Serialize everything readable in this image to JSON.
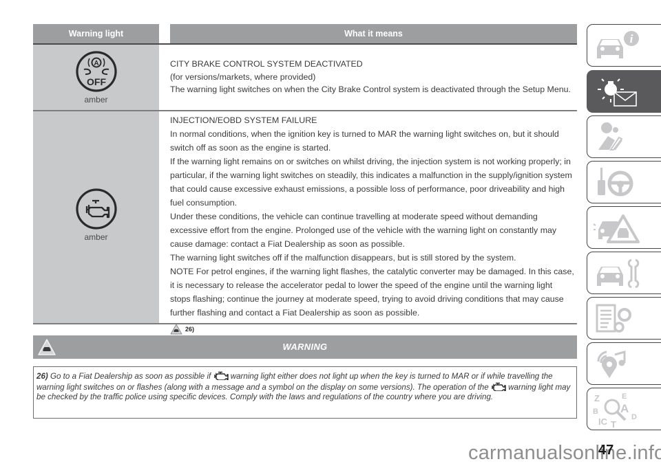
{
  "table": {
    "headers": {
      "warning_light": "Warning light",
      "what_it_means": "What it means"
    },
    "rows": [
      {
        "icon": "city-brake-off-icon",
        "color_label": "amber",
        "lines": [
          "CITY BRAKE CONTROL SYSTEM DEACTIVATED",
          "(for versions/markets, where provided)",
          "The warning light switches on when the City Brake Control system is deactivated through the Setup Menu."
        ]
      },
      {
        "icon": "engine-check-icon",
        "color_label": "amber",
        "lines": [
          "INJECTION/EOBD SYSTEM FAILURE",
          "In normal conditions, when the ignition key is turned to MAR the warning light switches on, but it should switch off as soon as the engine is started.",
          "If the warning light remains on or switches on whilst driving, the injection system is not working properly; in particular, if the warning light switches on steadily, this indicates a malfunction in the supply/ignition system that could cause excessive exhaust emissions, a possible loss of performance, poor driveability and high fuel consumption.",
          "Under these conditions, the vehicle can continue travelling at moderate speed without demanding excessive effort from the engine. Prolonged use of the vehicle with the warning light on constantly may cause damage: contact a Fiat Dealership as soon as possible.",
          "The warning light switches off if the malfunction disappears, but is still stored by the system.",
          "NOTE For petrol engines, if the warning light flashes, the catalytic converter may be damaged. In this case, it is necessary to release the accelerator pedal to lower the speed of the engine until the warning light stops flashing; continue the journey at moderate speed, trying to avoid driving conditions that may cause further flashing and contact a Fiat Dealership as soon as possible."
        ],
        "reference": "26)"
      }
    ]
  },
  "warning": {
    "title": "WARNING",
    "ref_number": "26)",
    "text_part1": " Go to a Fiat Dealership as soon as possible if ",
    "text_part2": " warning light either does not light up when the key is turned to MAR or if while travelling the warning light switches on or flashes (along with a message and a symbol on the display on some versions). The operation of the ",
    "text_part3": " warning light may be checked by the traffic police using specific devices. Comply with the laws and regulations of the country where you are driving."
  },
  "sidebar": {
    "tabs": [
      {
        "name": "car-info-icon",
        "active": false
      },
      {
        "name": "warning-lights-messages-icon",
        "active": true
      },
      {
        "name": "safety-airbag-icon",
        "active": false
      },
      {
        "name": "key-steering-wheel-icon",
        "active": false
      },
      {
        "name": "emergency-icon",
        "active": false
      },
      {
        "name": "maintenance-icon",
        "active": false
      },
      {
        "name": "technical-data-icon",
        "active": false
      },
      {
        "name": "multimedia-icon",
        "active": false
      },
      {
        "name": "index-icon",
        "active": false
      }
    ]
  },
  "footer": {
    "page_number": "47",
    "watermark": "carmanualsonline.info"
  },
  "colors": {
    "header_gray": "#9d9ea0",
    "cell_gray": "#c8c9cb",
    "active_tab": "#5a5a5c",
    "icon_gray": "#c8c8ca"
  }
}
